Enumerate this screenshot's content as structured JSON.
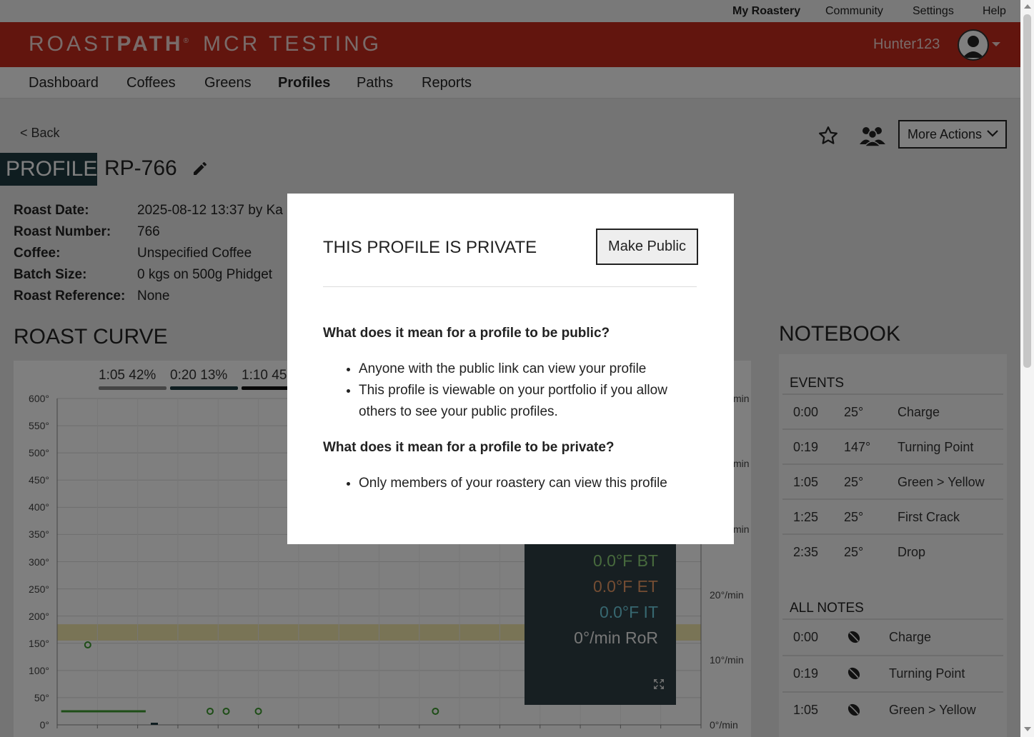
{
  "top_links": {
    "my_roastery": "My Roastery",
    "community": "Community",
    "settings": "Settings",
    "help": "Help"
  },
  "brand": {
    "name_light": "ROAST",
    "name_bold": "PATH",
    "registered": "®",
    "roastery": "MCR TESTING"
  },
  "user": {
    "name": "Hunter123"
  },
  "nav": {
    "dashboard": "Dashboard",
    "coffees": "Coffees",
    "greens": "Greens",
    "profiles": "Profiles",
    "paths": "Paths",
    "reports": "Reports"
  },
  "page": {
    "back": "< Back",
    "more_actions": "More Actions",
    "profile_tag": "PROFILE",
    "profile_name": "RP-766"
  },
  "meta": [
    {
      "label": "Roast Date:",
      "value": "2025-08-12 13:37 by Ka"
    },
    {
      "label": "Roast Number:",
      "value": "766"
    },
    {
      "label": "Coffee:",
      "value": "Unspecified Coffee"
    },
    {
      "label": "Batch Size:",
      "value": "0 kgs on 500g Phidget"
    },
    {
      "label": "Roast Reference:",
      "value": "None"
    }
  ],
  "roast_curve": {
    "title": "ROAST CURVE",
    "phase_stats": [
      {
        "text": "1:05 42%",
        "color": "#8a8a8a"
      },
      {
        "text": "0:20 13%",
        "color": "#1f3a40"
      },
      {
        "text": "1:10 45",
        "color": "#111111"
      }
    ],
    "readout": {
      "bt": "0.0°F BT",
      "et": "0.0°F ET",
      "it": "0.0°F IT",
      "ror": "0°/min RoR"
    }
  },
  "chart_data": {
    "type": "line",
    "title": "ROAST CURVE",
    "ylim": [
      0,
      600
    ],
    "y_ticks": [
      "600°",
      "550°",
      "500°",
      "450°",
      "400°",
      "350°",
      "300°",
      "250°",
      "200°",
      "150°",
      "100°",
      "50°",
      "0°"
    ],
    "y2_ticks": [
      "20°/min",
      "10°/min",
      "0°/min"
    ],
    "y2_ticks_partial": [
      "min",
      "min",
      "min"
    ],
    "band": {
      "y_from": 155,
      "y_to": 185,
      "color": "#e8d66a"
    },
    "grid": true,
    "series": [
      {
        "color": "#3c9a2e",
        "points": [
          [
            0,
            25
          ],
          [
            0.08,
            25
          ],
          [
            0.19,
            147
          ],
          [
            0.25,
            25
          ],
          [
            0.45,
            25
          ],
          [
            0.5,
            25
          ],
          [
            0.6,
            25
          ],
          [
            0.8,
            25
          ],
          [
            1.05,
            25
          ],
          [
            1.25,
            25
          ],
          [
            2.35,
            25
          ]
        ]
      }
    ],
    "markers": [
      [
        0.19,
        147
      ],
      [
        0.95,
        25
      ],
      [
        1.05,
        25
      ],
      [
        1.25,
        25
      ],
      [
        2.35,
        25
      ]
    ]
  },
  "notebook": {
    "title": "NOTEBOOK",
    "events_title": "EVENTS",
    "events": [
      {
        "time": "0:00",
        "temp": "25°",
        "name": "Charge"
      },
      {
        "time": "0:19",
        "temp": "147°",
        "name": "Turning Point"
      },
      {
        "time": "1:05",
        "temp": "25°",
        "name": "Green > Yellow"
      },
      {
        "time": "1:25",
        "temp": "25°",
        "name": "First Crack"
      },
      {
        "time": "2:35",
        "temp": "25°",
        "name": "Drop"
      }
    ],
    "notes_title": "ALL NOTES",
    "notes": [
      {
        "time": "0:00",
        "name": "Charge"
      },
      {
        "time": "0:19",
        "name": "Turning Point"
      },
      {
        "time": "1:05",
        "name": "Green > Yellow"
      }
    ]
  },
  "modal": {
    "title": "THIS PROFILE IS PRIVATE",
    "make_public": "Make Public",
    "q_public": "What does it mean for a profile to be public?",
    "public_points": [
      "Anyone with the public link can view your profile",
      "This profile is viewable on your portfolio if you allow others to see your public profiles."
    ],
    "q_private": "What does it mean for a profile to be private?",
    "private_points": [
      "Only members of your roastery can view this profile"
    ]
  }
}
